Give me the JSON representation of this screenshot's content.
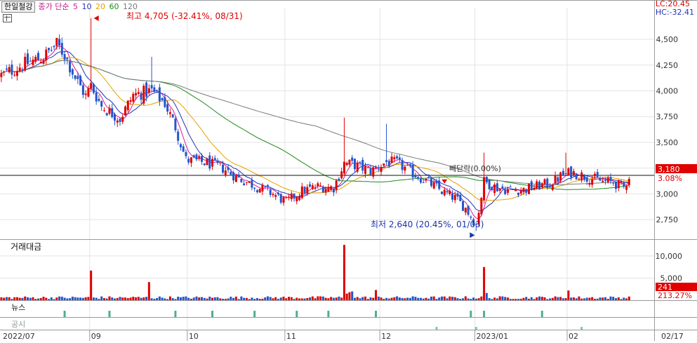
{
  "header": {
    "stock_name": "한일철강",
    "ma_label": "종가 단순",
    "ma_periods": [
      {
        "label": "5",
        "color": "#d81b9a"
      },
      {
        "label": "10",
        "color": "#2233bb"
      },
      {
        "label": "20",
        "color": "#e6a100"
      },
      {
        "label": "60",
        "color": "#1e8a1e"
      },
      {
        "label": "120",
        "color": "#7a7a7a"
      }
    ],
    "lc_label": "LC:20.45",
    "hc_label": "HC:-32.41",
    "lc_color": "#e00000",
    "hc_color": "#2233bb"
  },
  "chart_data": {
    "type": "candlestick",
    "price_axis": {
      "ylim": [
        2560,
        4800
      ],
      "ticks": [
        "4,500",
        "4,250",
        "4,000",
        "3,750",
        "3,500",
        "3,250",
        "3,000",
        "2,750"
      ],
      "tick_values": [
        4500,
        4250,
        4000,
        3750,
        3500,
        3250,
        3000,
        2750
      ]
    },
    "x_axis": {
      "labels": [
        "2022/07",
        "09",
        "10",
        "11",
        "12",
        "2023/01",
        "02",
        "02/17"
      ],
      "label_index": [
        0,
        34,
        71,
        108,
        144,
        180,
        215,
        246
      ]
    },
    "annotations": {
      "high": {
        "text": "최고 4,705 (-32.41%, 08/31)",
        "value": 4705,
        "index": 34
      },
      "low": {
        "text": "최저 2,640 (20.45%, 01/03)",
        "value": 2640,
        "index": 180
      },
      "base_line": {
        "text": "빼닫락(0.00%)",
        "value": 3180
      },
      "current_price": "3,180",
      "change_pct": "3.08%"
    },
    "colors": {
      "up": "#e00000",
      "down": "#2255cc"
    },
    "volume_panel": {
      "title": "거래대금",
      "ticks": [
        "10,000",
        "5,000"
      ],
      "tick_values": [
        10000,
        5000
      ],
      "ylim": [
        0,
        13000
      ],
      "current_value": "241",
      "current_pct": "213.27%"
    },
    "news_panel": {
      "title": "뉴스"
    },
    "disclosure_panel": {
      "title": "공시"
    },
    "anchors": [
      [
        0,
        4150
      ],
      [
        8,
        4250
      ],
      [
        16,
        4330
      ],
      [
        21,
        4450
      ],
      [
        24,
        4350
      ],
      [
        28,
        4130
      ],
      [
        32,
        3950
      ],
      [
        34,
        4050
      ],
      [
        38,
        3850
      ],
      [
        45,
        3730
      ],
      [
        50,
        3960
      ],
      [
        57,
        4000
      ],
      [
        62,
        3880
      ],
      [
        66,
        3650
      ],
      [
        70,
        3330
      ],
      [
        78,
        3300
      ],
      [
        84,
        3250
      ],
      [
        90,
        3150
      ],
      [
        96,
        3080
      ],
      [
        103,
        3000
      ],
      [
        108,
        2920
      ],
      [
        114,
        3030
      ],
      [
        120,
        3070
      ],
      [
        126,
        3060
      ],
      [
        130,
        3300
      ],
      [
        134,
        3280
      ],
      [
        140,
        3220
      ],
      [
        146,
        3310
      ],
      [
        150,
        3300
      ],
      [
        156,
        3200
      ],
      [
        162,
        3110
      ],
      [
        168,
        3010
      ],
      [
        172,
        2960
      ],
      [
        176,
        2860
      ],
      [
        180,
        2700
      ],
      [
        183,
        3120
      ],
      [
        188,
        3060
      ],
      [
        192,
        3040
      ],
      [
        198,
        3040
      ],
      [
        204,
        3080
      ],
      [
        208,
        3100
      ],
      [
        212,
        3170
      ],
      [
        216,
        3210
      ],
      [
        220,
        3180
      ],
      [
        224,
        3150
      ],
      [
        228,
        3120
      ],
      [
        232,
        3110
      ],
      [
        236,
        3060
      ],
      [
        238,
        3180
      ]
    ],
    "spikes": [
      {
        "index": 34,
        "value": 4705
      },
      {
        "index": 57,
        "value": 4330
      },
      {
        "index": 130,
        "value": 3740
      },
      {
        "index": 146,
        "value": 3680
      },
      {
        "index": 183,
        "value": 3400
      },
      {
        "index": 214,
        "value": 3400
      }
    ],
    "volume_spikes": [
      {
        "index": 34,
        "value": 6700
      },
      {
        "index": 56,
        "value": 4100
      },
      {
        "index": 130,
        "value": 12500
      },
      {
        "index": 142,
        "value": 2300
      },
      {
        "index": 183,
        "value": 7500
      },
      {
        "index": 215,
        "value": 2200
      }
    ],
    "news_marks": [
      24,
      41,
      66,
      80,
      96,
      112,
      124,
      142,
      178,
      183,
      205
    ],
    "disclosure_marks": [
      165,
      180,
      220
    ]
  }
}
